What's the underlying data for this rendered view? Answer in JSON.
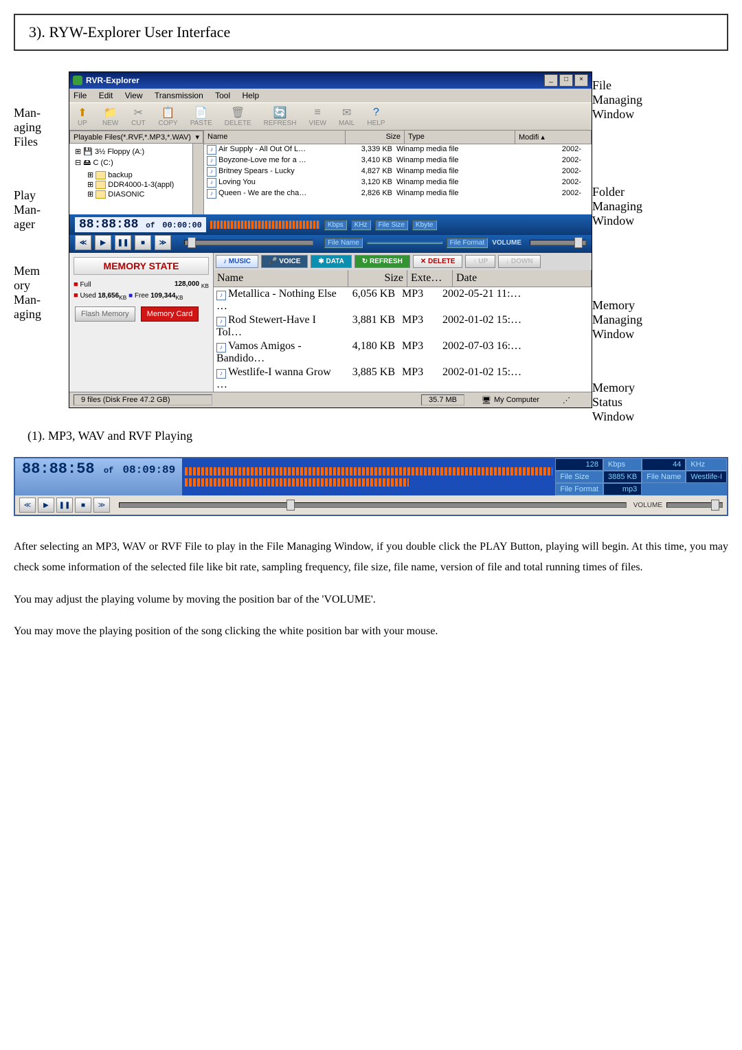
{
  "page_title": "3). RYW-Explorer User Interface",
  "leftLabels": {
    "fileManaging": "Man-\naging Files",
    "playManager": "Play Man-\nager",
    "memoryManaging": "Mem\nory Man-\naging"
  },
  "rightLabels": {
    "fileWindow": "File Managing Window",
    "folderWindow": "Folder Managing Window",
    "memoryWindow": "Memory Managing Window",
    "memStatus": "Memory Status Window"
  },
  "app": {
    "title": "RVR-Explorer",
    "menubar": [
      "File",
      "Edit",
      "View",
      "Transmission",
      "Tool",
      "Help"
    ],
    "toolbar": [
      "UP",
      "NEW",
      "CUT",
      "COPY",
      "PASTE",
      "DELETE",
      "REFRESH",
      "VIEW",
      "MAIL",
      "HELP"
    ]
  },
  "tree": {
    "header": "Playable Files(*.RVF,*.MP3,*.WAV)",
    "items": [
      {
        "icon": "floppy",
        "label": "3½ Floppy (A:)",
        "indent": 1,
        "prefix": "⊞"
      },
      {
        "icon": "drive",
        "label": "C (C:)",
        "indent": 1,
        "prefix": "⊟"
      },
      {
        "icon": "folder",
        "label": "backup",
        "indent": 2,
        "prefix": "⊞"
      },
      {
        "icon": "folder",
        "label": "DDR4000-1-3(appl)",
        "indent": 2,
        "prefix": "⊞"
      },
      {
        "icon": "folder",
        "label": "DIASONIC",
        "indent": 2,
        "prefix": "⊞"
      }
    ]
  },
  "fileList": {
    "headers": {
      "name": "Name",
      "size": "Size",
      "type": "Type",
      "mod": "Modifi"
    },
    "rows": [
      {
        "name": "Air Supply - All Out Of L…",
        "size": "3,339 KB",
        "type": "Winamp media file",
        "mod": "2002-"
      },
      {
        "name": "Boyzone-Love me for a …",
        "size": "3,410 KB",
        "type": "Winamp media file",
        "mod": "2002-"
      },
      {
        "name": "Britney Spears - Lucky",
        "size": "4,827 KB",
        "type": "Winamp media file",
        "mod": "2002-"
      },
      {
        "name": "Loving You",
        "size": "3,120 KB",
        "type": "Winamp media file",
        "mod": "2002-"
      },
      {
        "name": "Queen - We are the cha…",
        "size": "2,826 KB",
        "type": "Winamp media file",
        "mod": "2002-"
      }
    ]
  },
  "player": {
    "time": "88:88:88",
    "ofLabel": "of",
    "total": "00:00:00",
    "kbpsL": "Kbps",
    "khzL": "KHz",
    "fsL": "File Size",
    "kbL": "Kbyte",
    "fnL": "File Name",
    "ffL": "File Format",
    "volumeL": "VOLUME"
  },
  "memory": {
    "title1": "MEMORY",
    "title2": "STATE",
    "full": "Full",
    "fullv": "128,000",
    "used": "Used",
    "usedv": "18,656",
    "free": "Free",
    "freev": "109,344",
    "unit": "KB",
    "btns": {
      "flash": "Flash Memory",
      "card": "Memory Card"
    }
  },
  "memTabs": {
    "music": "MUSIC",
    "voice": "VOICE",
    "data": "DATA",
    "refresh": "REFRESH",
    "delete": "DELETE",
    "up": "UP",
    "down": "DOWN"
  },
  "memList": {
    "headers": {
      "name": "Name",
      "size": "Size",
      "ext": "Exte…",
      "date": "Date"
    },
    "rows": [
      {
        "name": "Metallica - Nothing Else …",
        "size": "6,056 KB",
        "ext": "MP3",
        "date": "2002-05-21 11:…"
      },
      {
        "name": "Rod Stewert-Have I Tol…",
        "size": "3,881 KB",
        "ext": "MP3",
        "date": "2002-01-02 15:…"
      },
      {
        "name": "Vamos Amigos - Bandido…",
        "size": "4,180 KB",
        "ext": "MP3",
        "date": "2002-07-03 16:…"
      },
      {
        "name": "Westlife-I wanna Grow …",
        "size": "3,885 KB",
        "ext": "MP3",
        "date": "2002-01-02 15:…"
      }
    ]
  },
  "status": {
    "files": "9 files (Disk Free 47.2 GB)",
    "size": "35.7 MB",
    "loc": "My Computer"
  },
  "subTitle": "(1). MP3, WAV and RVF Playing",
  "detail": {
    "lcd": "88:88:58",
    "ofLabel": "of",
    "total": "08:09:89",
    "kbps": "128",
    "kbpsL": "Kbps",
    "khz": "44",
    "khzL": "KHz",
    "fsL": "File Size",
    "fs": "3885",
    "fsU": "KB",
    "fnL": "File Name",
    "fn": "Westlife-I",
    "ffL": "File Format",
    "ff": "mp3",
    "volumeL": "VOLUME"
  },
  "bodyText": {
    "p1": "After selecting an MP3, WAV or RVF File to play in the File Managing Window, if you double click the PLAY Button, playing will begin. At this time, you may check some information of the selected file like bit rate, sampling frequency, file size, file name, version of file and total running times of files.",
    "p2": "You may adjust the playing volume by moving the position bar of the 'VOLUME'.",
    "p3": "You may move the playing position of the song clicking the white position bar with your mouse."
  }
}
